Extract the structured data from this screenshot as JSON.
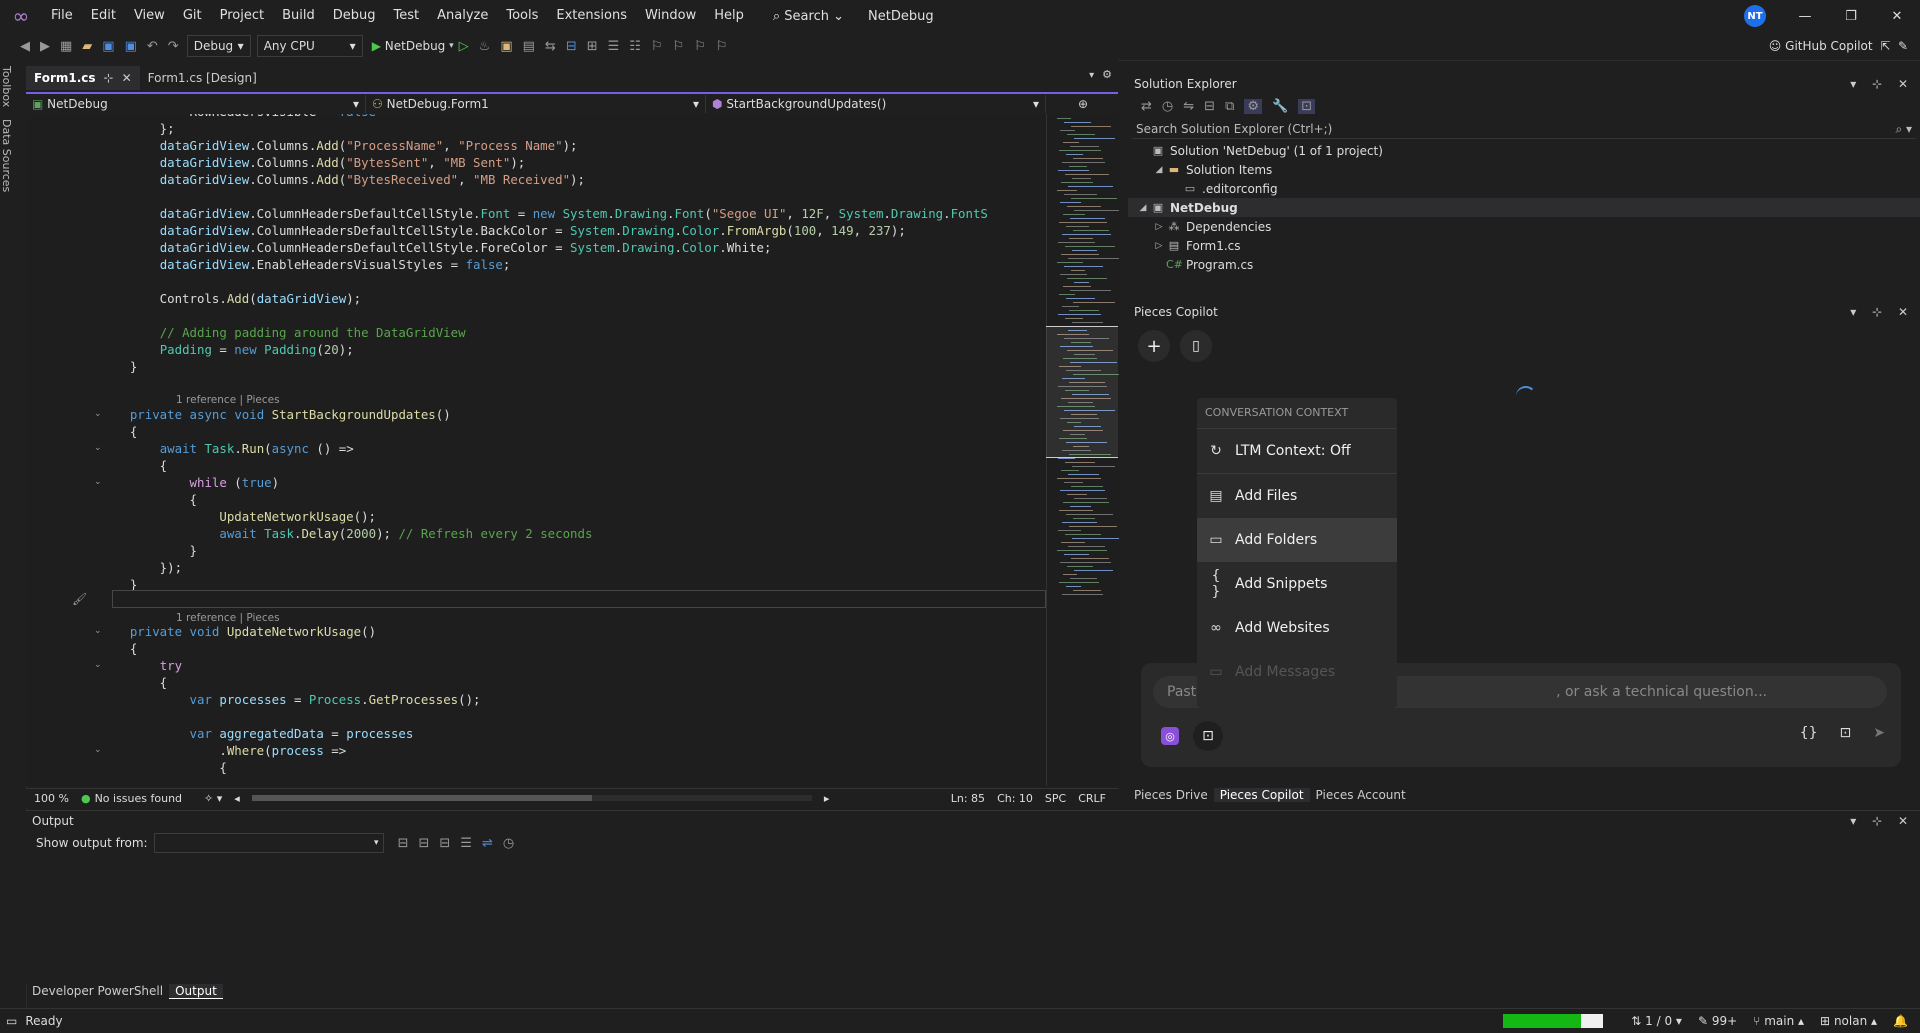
{
  "menu": {
    "items": [
      "File",
      "Edit",
      "View",
      "Git",
      "Project",
      "Build",
      "Debug",
      "Test",
      "Analyze",
      "Tools",
      "Extensions",
      "Window",
      "Help"
    ],
    "search": "Search",
    "project_name": "NetDebug",
    "avatar_initials": "NT"
  },
  "toolbar": {
    "config": "Debug",
    "platform": "Any CPU",
    "run_target": "NetDebug",
    "copilot": "GitHub Copilot"
  },
  "leftrail": {
    "toolbox": "Toolbox",
    "datasources": "Data Sources"
  },
  "editor": {
    "tabs": [
      {
        "label": "Form1.cs",
        "active": true
      },
      {
        "label": "Form1.cs [Design]",
        "active": false
      }
    ],
    "nav": {
      "project": "NetDebug",
      "class": "NetDebug.Form1",
      "member": "StartBackgroundUpdates()"
    },
    "lens1": "1 reference | Pieces",
    "lens2": "1 reference | Pieces",
    "code": [
      "            RowHeadersVisible = false",
      "        };",
      "        dataGridView.Columns.Add(\"ProcessName\", \"Process Name\");",
      "        dataGridView.Columns.Add(\"BytesSent\", \"MB Sent\");",
      "        dataGridView.Columns.Add(\"BytesReceived\", \"MB Received\");",
      "",
      "        dataGridView.ColumnHeadersDefaultCellStyle.Font = new System.Drawing.Font(\"Segoe UI\", 12F, System.Drawing.FontS",
      "        dataGridView.ColumnHeadersDefaultCellStyle.BackColor = System.Drawing.Color.FromArgb(100, 149, 237);",
      "        dataGridView.ColumnHeadersDefaultCellStyle.ForeColor = System.Drawing.Color.White;",
      "        dataGridView.EnableHeadersVisualStyles = false;",
      "",
      "        Controls.Add(dataGridView);",
      "",
      "        // Adding padding around the DataGridView",
      "        Padding = new Padding(20);",
      "    }",
      "",
      "    private async void StartBackgroundUpdates()",
      "    {",
      "        await Task.Run(async () =>",
      "        {",
      "            while (true)",
      "            {",
      "                UpdateNetworkUsage();",
      "                await Task.Delay(2000); // Refresh every 2 seconds",
      "            }",
      "        });",
      "    }",
      "",
      "    private void UpdateNetworkUsage()",
      "    {",
      "        try",
      "        {",
      "            var processes = Process.GetProcesses();",
      "",
      "            var aggregatedData = processes",
      "                .Where(process =>",
      "                {"
    ],
    "status": {
      "zoom": "100 %",
      "issues": "No issues found",
      "line": "Ln: 85",
      "col": "Ch: 10",
      "spc": "SPC",
      "eol": "CRLF"
    }
  },
  "solution_explorer": {
    "title": "Solution Explorer",
    "search_placeholder": "Search Solution Explorer (Ctrl+;)",
    "tree": [
      {
        "label": "Solution 'NetDebug' (1 of 1 project)",
        "indent": 0,
        "arrow": "",
        "icon": "▣"
      },
      {
        "label": "Solution Items",
        "indent": 1,
        "arrow": "◢",
        "icon": "▬"
      },
      {
        "label": ".editorconfig",
        "indent": 2,
        "arrow": "",
        "icon": "▭"
      },
      {
        "label": "NetDebug",
        "indent": 0,
        "arrow": "◢",
        "icon": "▣",
        "selected": true
      },
      {
        "label": "Dependencies",
        "indent": 1,
        "arrow": "▷",
        "icon": "⁂"
      },
      {
        "label": "Form1.cs",
        "indent": 1,
        "arrow": "▷",
        "icon": "▤"
      },
      {
        "label": "Program.cs",
        "indent": 1,
        "arrow": "",
        "icon": "C#"
      }
    ]
  },
  "pieces": {
    "title": "Pieces Copilot",
    "context_header": "CONVERSATION CONTEXT",
    "ltm": "LTM Context: Off",
    "items": [
      "Add Files",
      "Add Folders",
      "Add Snippets",
      "Add Websites",
      "Add Messages"
    ],
    "input_left": "Past",
    "input_right": ", or ask a technical question...",
    "tabs": [
      "Pieces Drive",
      "Pieces Copilot",
      "Pieces Account"
    ]
  },
  "output": {
    "title": "Output",
    "show_from": "Show output from:",
    "tabs": [
      "Developer PowerShell",
      "Output"
    ]
  },
  "statusbar": {
    "ready": "Ready",
    "progress": 0.78,
    "sync": "1 / 0",
    "changes": "99+",
    "branch": "main",
    "user": "nolan",
    "colors": {
      "progress_fill": "#14b814",
      "accent": "#7160e8"
    }
  }
}
